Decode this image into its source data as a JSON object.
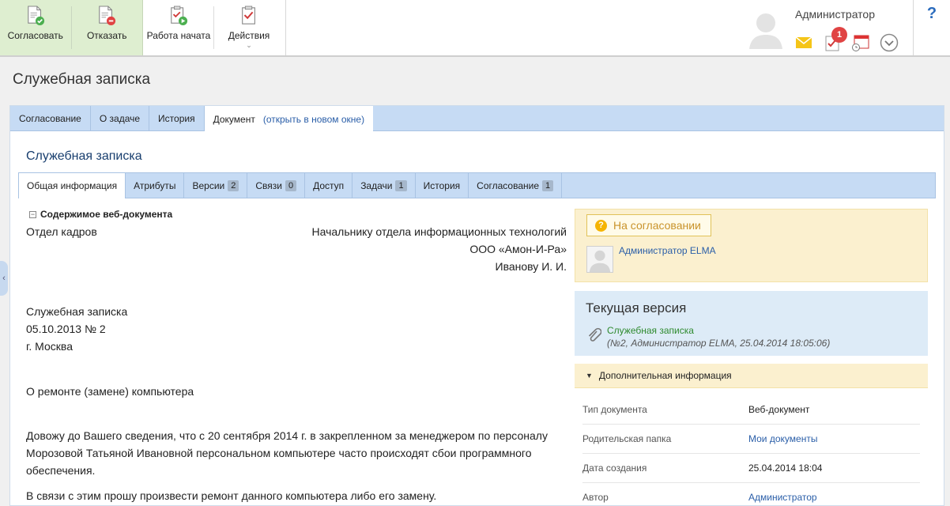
{
  "toolbar": {
    "approve_label": "Согласовать",
    "reject_label": "Отказать",
    "work_started_label": "Работа начата",
    "actions_label": "Действия"
  },
  "user": {
    "name": "Администратор",
    "task_badge": "1"
  },
  "help": "?",
  "page_title": "Служебная записка",
  "top_tabs": {
    "t1": "Согласование",
    "t2": "О задаче",
    "t3": "История",
    "t4": "Документ",
    "open_new": "(открыть в новом окне)"
  },
  "doc_title": "Служебная записка",
  "inner_tabs": {
    "general": "Общая информация",
    "attributes": "Атрибуты",
    "versions": "Версии",
    "versions_count": "2",
    "links": "Связи",
    "links_count": "0",
    "access": "Доступ",
    "tasks": "Задачи",
    "tasks_count": "1",
    "history": "История",
    "approval": "Согласование",
    "approval_count": "1"
  },
  "content": {
    "section": "Содержимое веб-документа",
    "from_dept": "Отдел кадров",
    "to_line1": "Начальнику отдела информационных технологий",
    "to_line2": "ООО «Амон-И-Ра»",
    "to_line3": "Иванову И. И.",
    "memo_type": "Служебная записка",
    "memo_date": "05.10.2013 № 2",
    "memo_city": "г. Москва",
    "subject": "О ремонте (замене) компьютера",
    "para1": "Довожу до Вашего сведения, что с 20 сентября 2014 г. в закрепленном за менеджером по персоналу Морозовой Татьяной Ивановной персональном компьютере часто происходят сбои программного обеспечения.",
    "para2": "В связи с этим прошу произвести ремонт данного компьютера либо его замену."
  },
  "status": {
    "label": "На согласовании",
    "approver": "Администратор ELMA"
  },
  "version": {
    "title": "Текущая версия",
    "file": "Служебная записка",
    "meta": "(№2, Администратор ELMA, 25.04.2014 18:05:06)"
  },
  "additional": {
    "title": "Дополнительная информация",
    "rows": [
      {
        "label": "Тип документа",
        "value": "Веб-документ"
      },
      {
        "label": "Родительская папка",
        "value": "Мои документы"
      },
      {
        "label": "Дата создания",
        "value": "25.04.2014 18:04"
      },
      {
        "label": "Автор",
        "value": "Администратор"
      }
    ]
  },
  "colors": {
    "accent_blue": "#c6dbf4",
    "status_yellow": "#fbf0cf",
    "version_blue": "#ddebf7",
    "green_toolbar": "#deeed0"
  }
}
